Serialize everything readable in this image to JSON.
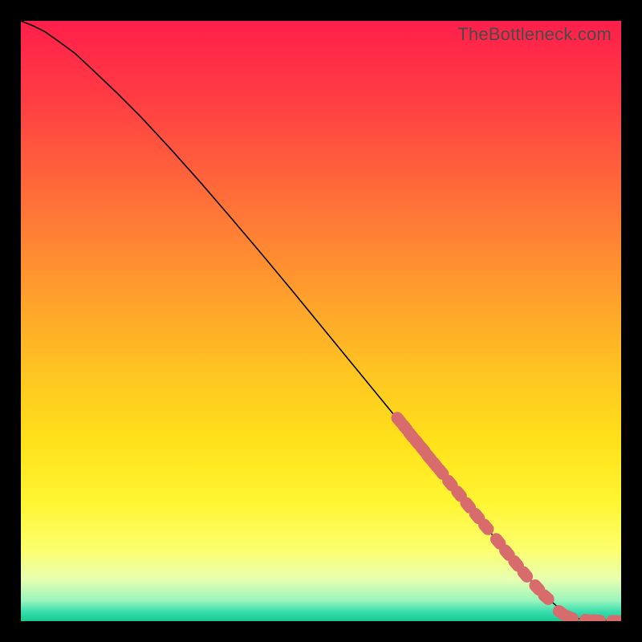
{
  "watermark": "TheBottleneck.com",
  "colors": {
    "background": "#000000",
    "gradient_stops": [
      {
        "offset": 0.0,
        "color": "#ff1f4b"
      },
      {
        "offset": 0.12,
        "color": "#ff3a44"
      },
      {
        "offset": 0.28,
        "color": "#ff6a3a"
      },
      {
        "offset": 0.44,
        "color": "#ff9a2e"
      },
      {
        "offset": 0.58,
        "color": "#ffc322"
      },
      {
        "offset": 0.7,
        "color": "#ffe11a"
      },
      {
        "offset": 0.8,
        "color": "#fff531"
      },
      {
        "offset": 0.88,
        "color": "#fdff6e"
      },
      {
        "offset": 0.93,
        "color": "#e8ffb0"
      },
      {
        "offset": 0.965,
        "color": "#9cf5bc"
      },
      {
        "offset": 0.985,
        "color": "#36ddad"
      },
      {
        "offset": 1.0,
        "color": "#17c98f"
      }
    ],
    "line": "#000000",
    "marker": "#d86b6b"
  },
  "chart_data": {
    "type": "line",
    "title": "",
    "xlabel": "",
    "ylabel": "",
    "xlim": [
      0,
      100
    ],
    "ylim": [
      0,
      100
    ],
    "series": [
      {
        "name": "curve",
        "x": [
          0,
          2,
          4,
          6,
          9,
          12,
          16,
          20,
          25,
          30,
          35,
          40,
          45,
          50,
          55,
          60,
          65,
          70,
          75,
          80,
          84,
          87,
          89.5,
          91,
          93,
          96,
          100
        ],
        "y": [
          100,
          99.2,
          98.2,
          96.8,
          94.6,
          91.8,
          88.0,
          84.0,
          78.6,
          73.0,
          67.2,
          61.3,
          55.3,
          49.2,
          43.1,
          37.0,
          30.9,
          24.8,
          18.7,
          12.6,
          7.8,
          4.5,
          2.3,
          1.2,
          0.4,
          0.1,
          0.0
        ]
      }
    ],
    "markers": [
      {
        "x": 63,
        "y": 33.5
      },
      {
        "x": 64,
        "y": 32.3
      },
      {
        "x": 65,
        "y": 31.0
      },
      {
        "x": 66,
        "y": 29.8
      },
      {
        "x": 67,
        "y": 28.6
      },
      {
        "x": 68,
        "y": 27.3
      },
      {
        "x": 69,
        "y": 26.1
      },
      {
        "x": 70,
        "y": 24.9
      },
      {
        "x": 71.5,
        "y": 23.0
      },
      {
        "x": 73,
        "y": 21.2
      },
      {
        "x": 74.5,
        "y": 19.3
      },
      {
        "x": 76,
        "y": 17.5
      },
      {
        "x": 77.5,
        "y": 15.7
      },
      {
        "x": 79.5,
        "y": 13.3
      },
      {
        "x": 81,
        "y": 11.4
      },
      {
        "x": 82.5,
        "y": 9.6
      },
      {
        "x": 84,
        "y": 7.8
      },
      {
        "x": 86,
        "y": 5.6
      },
      {
        "x": 87.5,
        "y": 4.0
      },
      {
        "x": 90,
        "y": 1.4
      },
      {
        "x": 91.5,
        "y": 0.6
      },
      {
        "x": 94.5,
        "y": 0.15
      },
      {
        "x": 96,
        "y": 0.1
      },
      {
        "x": 99,
        "y": 0.0
      }
    ]
  }
}
